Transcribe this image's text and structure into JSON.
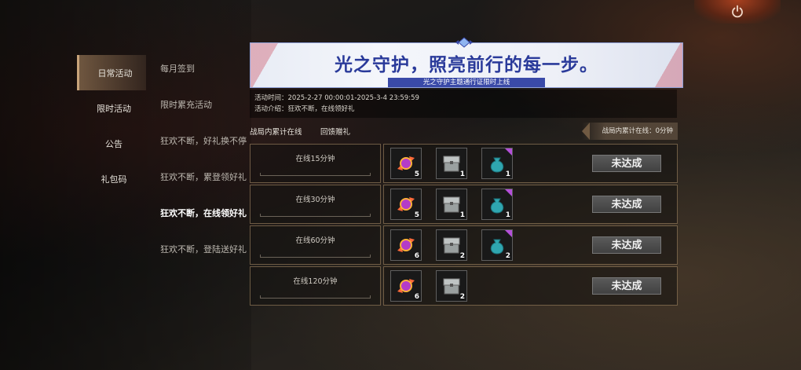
{
  "sidebar": {
    "items": [
      {
        "label": "日常活动",
        "active": true
      },
      {
        "label": "限时活动",
        "active": false
      },
      {
        "label": "公告",
        "active": false
      },
      {
        "label": "礼包码",
        "active": false
      }
    ]
  },
  "subnav": {
    "items": [
      {
        "label": "每月签到",
        "active": false
      },
      {
        "label": "限时累充活动",
        "active": false
      },
      {
        "label": "狂欢不断，好礼换不停",
        "active": false
      },
      {
        "label": "狂欢不断，累登领好礼",
        "active": false
      },
      {
        "label": "狂欢不断，在线领好礼",
        "active": true
      },
      {
        "label": "狂欢不断，登陆送好礼",
        "active": false
      }
    ]
  },
  "banner": {
    "title": "光之守护，照亮前行的每一步。",
    "ribbon": "光之守护主题通行证限时上线"
  },
  "info": {
    "time": "活动时间：2025-2-27 00:00:01-2025-3-4 23:59:59",
    "intro": "活动介绍：狂欢不断，在线领好礼"
  },
  "tabs": {
    "tab1": "战局内累计在线",
    "tab2": "回馈赠礼",
    "progress": "战局内累计在线：0分钟"
  },
  "rows": [
    {
      "label": "在线15分钟",
      "status": "未达成",
      "rewards": [
        {
          "icon": "candy-icon",
          "count": "5"
        },
        {
          "icon": "crate-icon",
          "count": "1"
        },
        {
          "icon": "pouch-icon",
          "count": "1"
        }
      ]
    },
    {
      "label": "在线30分钟",
      "status": "未达成",
      "rewards": [
        {
          "icon": "candy-icon",
          "count": "5"
        },
        {
          "icon": "crate-icon",
          "count": "1"
        },
        {
          "icon": "pouch-icon",
          "count": "1"
        }
      ]
    },
    {
      "label": "在线60分钟",
      "status": "未达成",
      "rewards": [
        {
          "icon": "candy-icon",
          "count": "6"
        },
        {
          "icon": "crate-icon",
          "count": "2"
        },
        {
          "icon": "pouch-icon",
          "count": "2"
        }
      ]
    },
    {
      "label": "在线120分钟",
      "status": "未达成",
      "rewards": [
        {
          "icon": "candy-icon",
          "count": "6"
        },
        {
          "icon": "crate-icon",
          "count": "2"
        }
      ]
    }
  ],
  "colors": {
    "accent": "#c9a47a",
    "banner_text": "#2a3a9a",
    "rarity_purple": "#b44fd9"
  }
}
